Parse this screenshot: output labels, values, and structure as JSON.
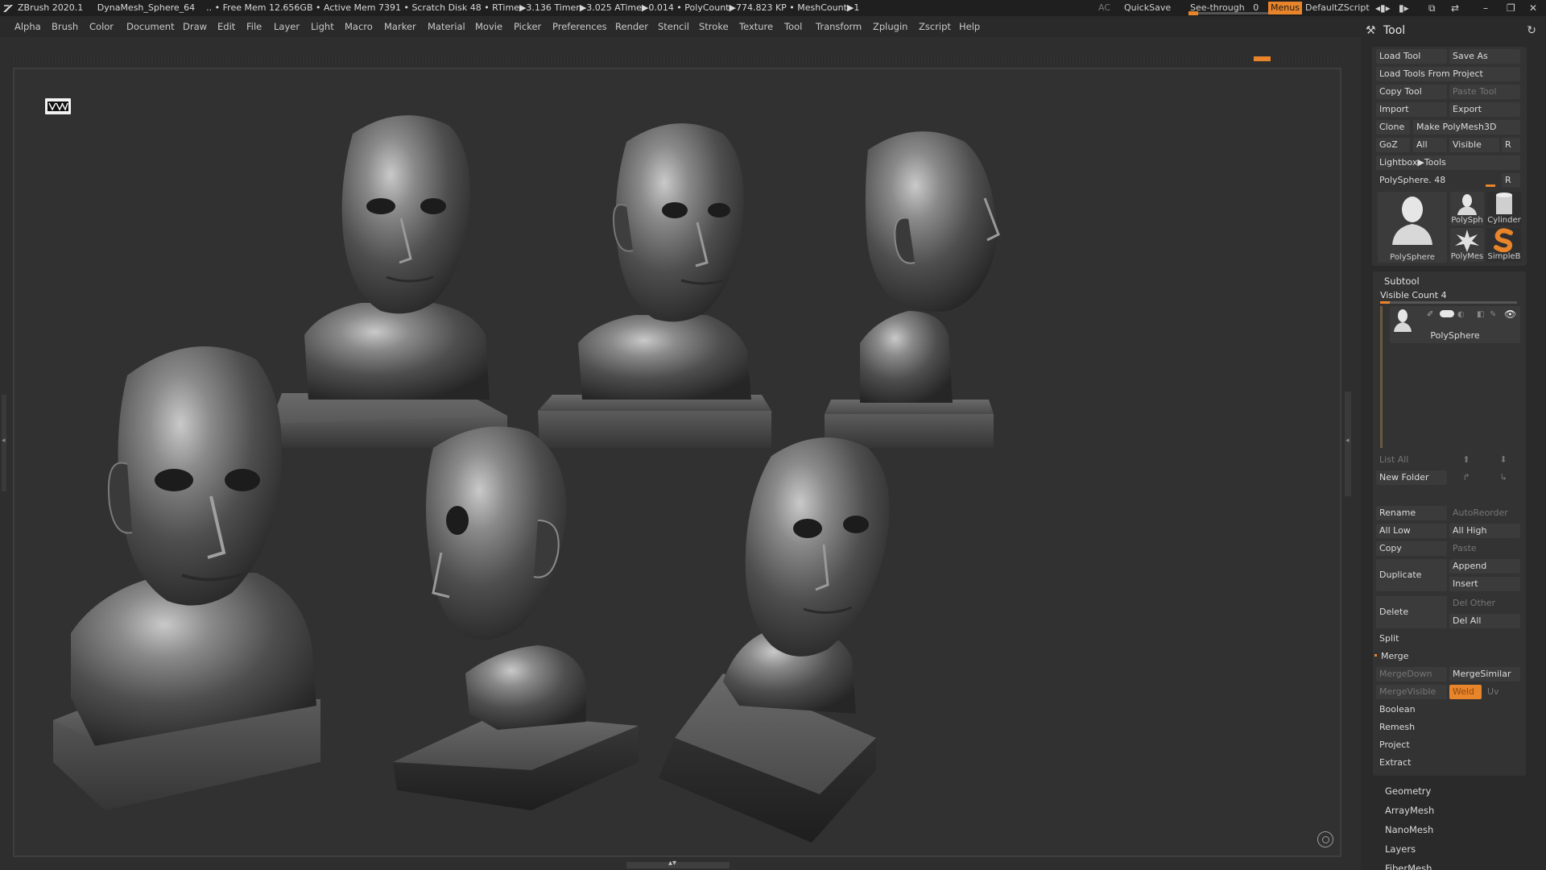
{
  "titlebar": {
    "app_title": "ZBrush 2020.1",
    "doc_name": "DynaMesh_Sphere_64",
    "stats": ".. • Free Mem 12.656GB • Active Mem 7391 • Scratch Disk 48 •  RTime▶3.136 Timer▶3.025 ATime▶0.014 • PolyCount▶774.823 KP  • MeshCount▶1",
    "ac": "AC",
    "quicksave": "QuickSave",
    "see_through_label": "See-through",
    "see_through_value": "0",
    "menus": "Menus",
    "default_zscript": "DefaultZScript"
  },
  "menubar": {
    "items": [
      "Alpha",
      "Brush",
      "Color",
      "Document",
      "Draw",
      "Edit",
      "File",
      "Layer",
      "Light",
      "Macro",
      "Marker",
      "Material",
      "Movie",
      "Picker",
      "Preferences",
      "Render",
      "Stencil",
      "Stroke",
      "Texture",
      "Tool",
      "Transform",
      "Zplugin",
      "Zscript",
      "Help"
    ]
  },
  "palette": {
    "title": "Tool",
    "load_tool": "Load Tool",
    "save_as": "Save As",
    "load_tools_from_project": "Load Tools From Project",
    "copy_tool": "Copy Tool",
    "paste_tool": "Paste Tool",
    "import": "Import",
    "export": "Export",
    "clone": "Clone",
    "make_polymesh3d": "Make PolyMesh3D",
    "goz": "GoZ",
    "all": "All",
    "visible": "Visible",
    "r": "R",
    "lightbox_tools": "Lightbox▶Tools",
    "polysphere_slider": "PolySphere. 48",
    "thumbs": {
      "main": "PolySphere",
      "polysphere_small": "PolySph",
      "cylinder": "Cylinder",
      "polymesh": "PolyMes",
      "simpleb": "SimpleB"
    }
  },
  "subtool": {
    "title": "Subtool",
    "visible_count": "Visible Count 4",
    "item_name": "PolySphere",
    "list_all": "List All",
    "new_folder": "New Folder",
    "rename": "Rename",
    "autoreorder": "AutoReorder",
    "all_low": "All Low",
    "all_high": "All High",
    "copy": "Copy",
    "paste": "Paste",
    "duplicate": "Duplicate",
    "append": "Append",
    "insert": "Insert",
    "delete": "Delete",
    "del_other": "Del Other",
    "del_all": "Del All",
    "split": "Split",
    "merge": "Merge",
    "mergedown": "MergeDown",
    "mergesimilar": "MergeSimilar",
    "mergevisible": "MergeVisible",
    "weld": "Weld",
    "uv": "Uv",
    "boolean": "Boolean",
    "remesh": "Remesh",
    "project": "Project",
    "extract": "Extract"
  },
  "sections": [
    "Geometry",
    "ArrayMesh",
    "NanoMesh",
    "Layers",
    "FiberMesh"
  ],
  "colors": {
    "accent": "#e8842a",
    "background": "#2e2e2e",
    "panel": "#333333"
  }
}
